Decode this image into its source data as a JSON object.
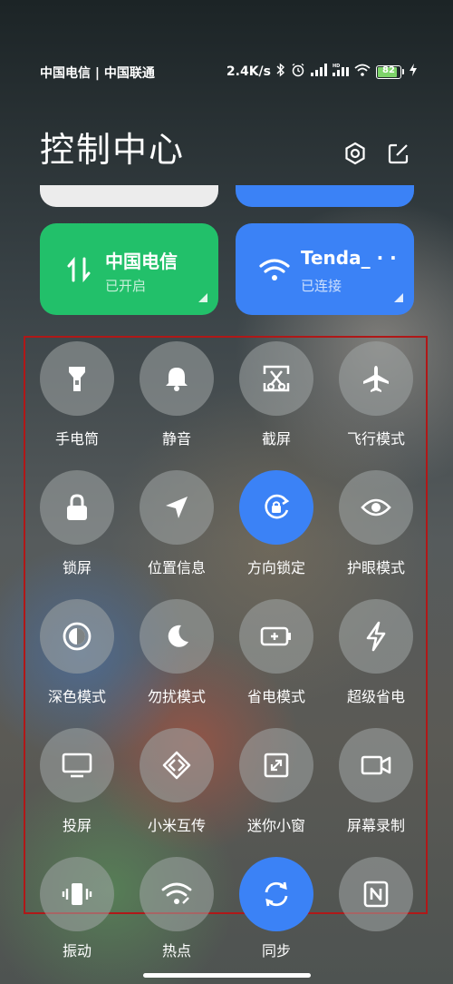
{
  "status_bar": {
    "carrier": "中国电信 | 中国联通",
    "net_speed": "2.4K/s",
    "battery_level": "82",
    "battery_fraction": 0.82,
    "icons": [
      "bluetooth-icon",
      "alarm-icon",
      "signal-icon",
      "hd-signal-icon",
      "wifi-icon",
      "battery-icon",
      "charging-icon"
    ]
  },
  "header": {
    "title": "控制中心",
    "icons": [
      "settings-icon",
      "edit-icon"
    ]
  },
  "cards": [
    {
      "title": "中国电信",
      "subtitle": "已开启",
      "icon": "mobile-data-icon",
      "color": "#22c06a"
    },
    {
      "title": "Tenda_ · ·",
      "subtitle": "已连接",
      "icon": "wifi-icon",
      "color": "#3b82f6"
    }
  ],
  "colors": {
    "accent": "#3b82f6",
    "green": "#22c06a",
    "highlight_border": "#b01818"
  },
  "tiles": [
    {
      "label": "手电筒",
      "icon": "flashlight-icon",
      "active": false
    },
    {
      "label": "静音",
      "icon": "bell-icon",
      "active": false
    },
    {
      "label": "截屏",
      "icon": "screenshot-icon",
      "active": false
    },
    {
      "label": "飞行模式",
      "icon": "airplane-icon",
      "active": false
    },
    {
      "label": "锁屏",
      "icon": "lock-icon",
      "active": false
    },
    {
      "label": "位置信息",
      "icon": "location-icon",
      "active": false
    },
    {
      "label": "方向锁定",
      "icon": "rotation-lock-icon",
      "active": true
    },
    {
      "label": "护眼模式",
      "icon": "eye-icon",
      "active": false
    },
    {
      "label": "深色模式",
      "icon": "dark-mode-icon",
      "active": false
    },
    {
      "label": "勿扰模式",
      "icon": "moon-icon",
      "active": false
    },
    {
      "label": "省电模式",
      "icon": "battery-saver-icon",
      "active": false
    },
    {
      "label": "超级省电",
      "icon": "lightning-icon",
      "active": false
    },
    {
      "label": "投屏",
      "icon": "cast-screen-icon",
      "active": false
    },
    {
      "label": "小米互传",
      "icon": "mi-share-icon",
      "active": false
    },
    {
      "label": "迷你小窗",
      "icon": "mini-window-icon",
      "active": false
    },
    {
      "label": "屏幕录制",
      "icon": "screen-record-icon",
      "active": false
    },
    {
      "label": "振动",
      "icon": "vibrate-icon",
      "active": false
    },
    {
      "label": "热点",
      "icon": "hotspot-icon",
      "active": false
    },
    {
      "label": "同步",
      "icon": "sync-icon",
      "active": true
    },
    {
      "label": "NFC",
      "icon": "nfc-icon",
      "active": false
    }
  ]
}
